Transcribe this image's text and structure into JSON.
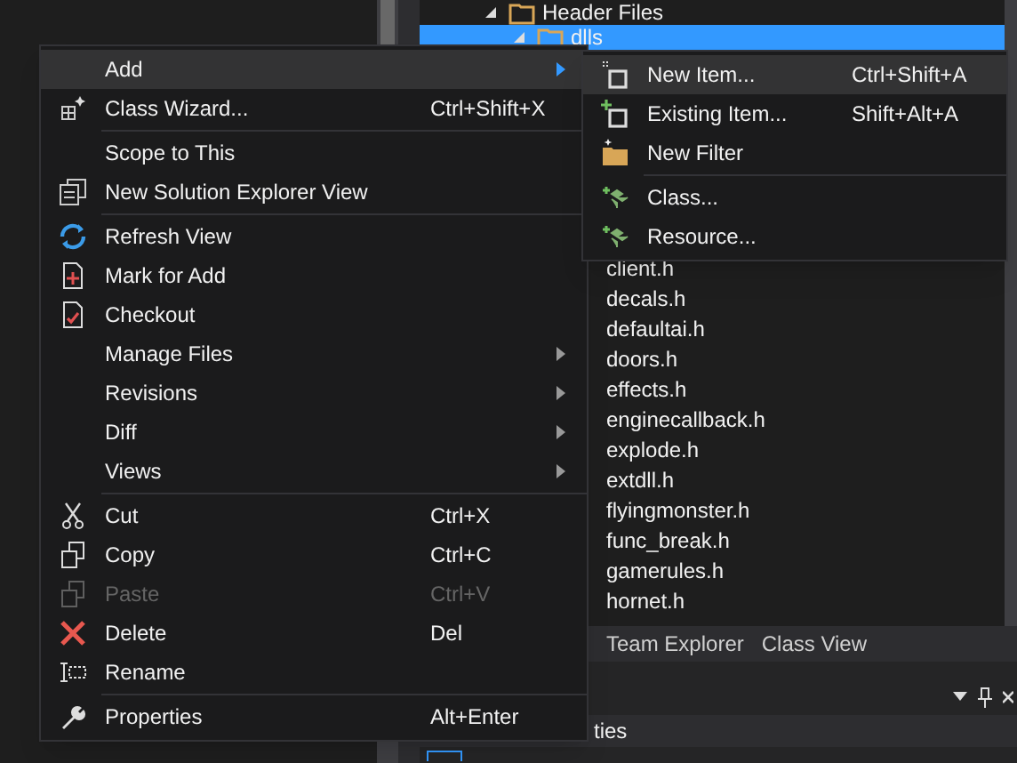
{
  "explorer": {
    "tree": [
      {
        "label": "Header Files",
        "expanded": true,
        "selected": false,
        "children": [
          {
            "label": "dlls",
            "expanded": true,
            "selected": true
          }
        ]
      }
    ],
    "files": [
      "client.h",
      "decals.h",
      "defaultai.h",
      "doors.h",
      "effects.h",
      "enginecallback.h",
      "explode.h",
      "extdll.h",
      "flyingmonster.h",
      "func_break.h",
      "gamerules.h",
      "hornet.h"
    ],
    "tabs": [
      {
        "label": "Team Explorer",
        "selected": false
      },
      {
        "label": "Class View",
        "selected": false
      }
    ]
  },
  "properties_panel": {
    "title": "ties"
  },
  "context_menu": {
    "groups": [
      [
        {
          "label": "Add",
          "submenu": true,
          "disabled": false,
          "selected": true
        },
        {
          "label": "Class Wizard...",
          "shortcut": "Ctrl+Shift+X",
          "submenu": false,
          "disabled": false,
          "selected": false
        }
      ],
      [
        {
          "label": "Scope to This",
          "submenu": false,
          "disabled": false,
          "selected": false
        },
        {
          "label": "New Solution Explorer View",
          "submenu": false,
          "disabled": false,
          "selected": false
        }
      ],
      [
        {
          "label": "Refresh View",
          "submenu": false,
          "disabled": false,
          "selected": false
        },
        {
          "label": "Mark for Add",
          "submenu": false,
          "disabled": false,
          "selected": false
        },
        {
          "label": "Checkout",
          "submenu": false,
          "disabled": false,
          "selected": false
        },
        {
          "label": "Manage Files",
          "submenu": true,
          "disabled": false,
          "selected": false
        },
        {
          "label": "Revisions",
          "submenu": true,
          "disabled": false,
          "selected": false
        },
        {
          "label": "Diff",
          "submenu": true,
          "disabled": false,
          "selected": false
        },
        {
          "label": "Views",
          "submenu": true,
          "disabled": false,
          "selected": false
        }
      ],
      [
        {
          "label": "Cut",
          "shortcut": "Ctrl+X",
          "submenu": false,
          "disabled": false,
          "selected": false
        },
        {
          "label": "Copy",
          "shortcut": "Ctrl+C",
          "submenu": false,
          "disabled": false,
          "selected": false
        },
        {
          "label": "Paste",
          "shortcut": "Ctrl+V",
          "submenu": false,
          "disabled": true,
          "selected": false
        },
        {
          "label": "Delete",
          "shortcut": "Del",
          "submenu": false,
          "disabled": false,
          "selected": false
        },
        {
          "label": "Rename",
          "submenu": false,
          "disabled": false,
          "selected": false
        }
      ],
      [
        {
          "label": "Properties",
          "shortcut": "Alt+Enter",
          "submenu": false,
          "disabled": false,
          "selected": false
        }
      ]
    ]
  },
  "add_submenu": {
    "groups": [
      [
        {
          "label": "New Item...",
          "shortcut": "Ctrl+Shift+A",
          "submenu": false,
          "disabled": false,
          "selected": true
        },
        {
          "label": "Existing Item...",
          "shortcut": "Shift+Alt+A",
          "submenu": false,
          "disabled": false,
          "selected": false
        },
        {
          "label": "New Filter",
          "submenu": false,
          "disabled": false,
          "selected": false
        }
      ],
      [
        {
          "label": "Class...",
          "submenu": false,
          "disabled": false,
          "selected": false
        },
        {
          "label": "Resource...",
          "submenu": false,
          "disabled": false,
          "selected": false
        }
      ]
    ]
  }
}
